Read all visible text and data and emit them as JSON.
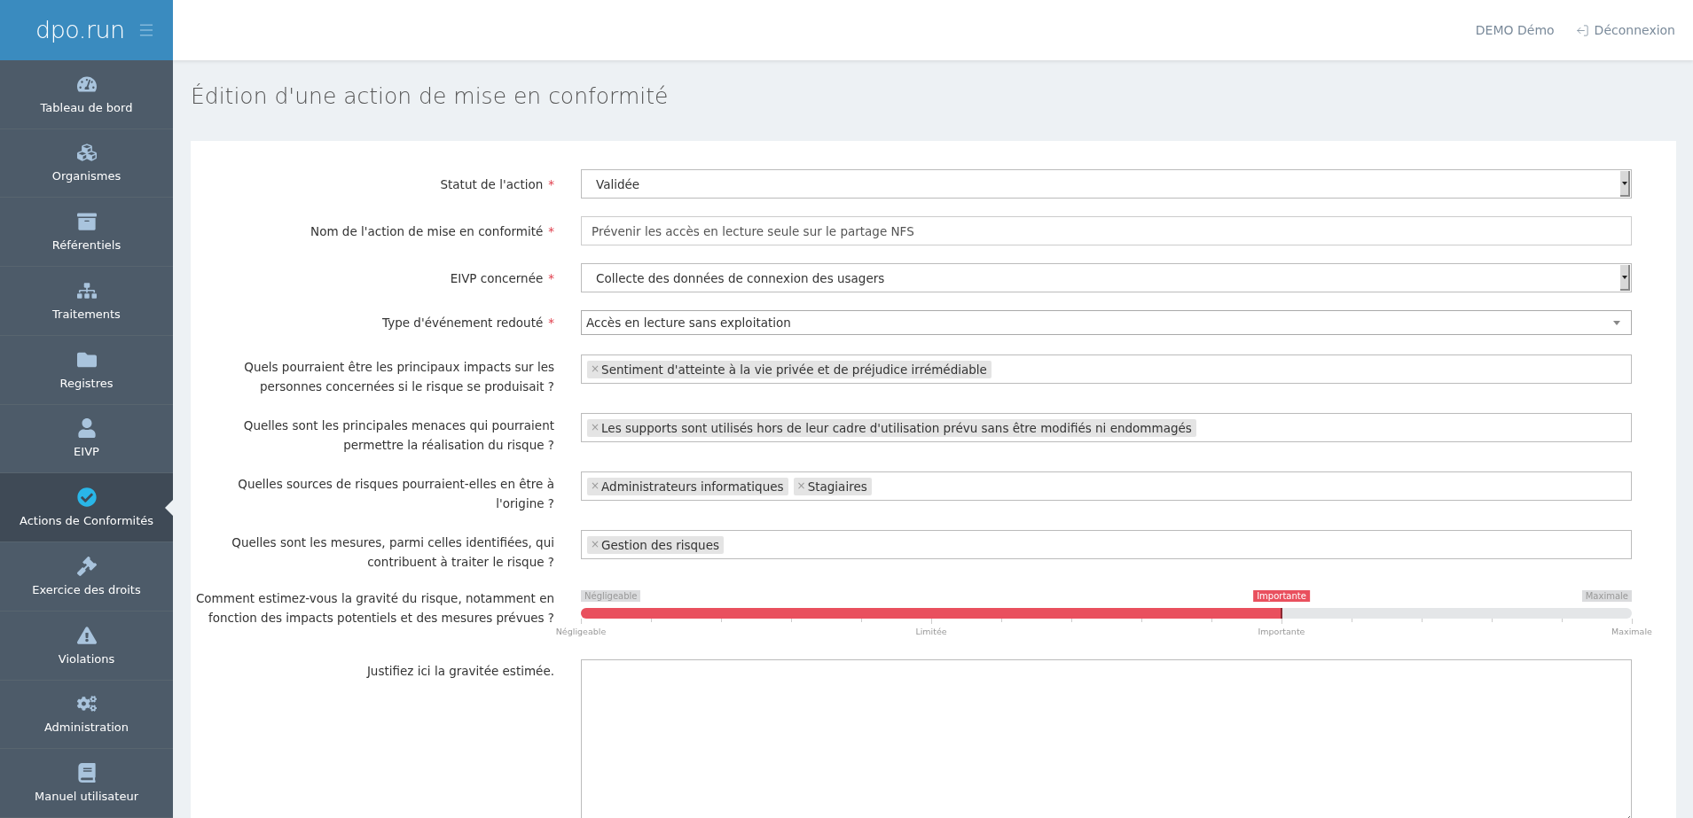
{
  "sidebar": {
    "logo": "dpo.run",
    "items": [
      {
        "label": "Tableau de bord",
        "selected": false
      },
      {
        "label": "Organismes",
        "selected": false
      },
      {
        "label": "Référentiels",
        "selected": false
      },
      {
        "label": "Traitements",
        "selected": false
      },
      {
        "label": "Registres",
        "selected": false
      },
      {
        "label": "EIVP",
        "selected": false
      },
      {
        "label": "Actions de Conformités",
        "selected": true
      },
      {
        "label": "Exercice des droits",
        "selected": false
      },
      {
        "label": "Violations",
        "selected": false
      },
      {
        "label": "Administration",
        "selected": false
      },
      {
        "label": "Manuel utilisateur",
        "selected": false
      }
    ]
  },
  "header": {
    "user": "DEMO Démo",
    "logout": "Déconnexion"
  },
  "page_title": "Édition d'une action de mise en conformité",
  "form": {
    "fields": [
      {
        "kind": "select",
        "label": "Statut de l'action",
        "required_mark": "*",
        "value": "Validée"
      },
      {
        "kind": "text",
        "label": "Nom de l'action de mise en conformité",
        "required_mark": "*",
        "value": "Prévenir les accès en lecture seule sur le partage NFS"
      },
      {
        "kind": "select",
        "label": "EIVP concernée",
        "required_mark": "*",
        "value": "Collecte des données de connexion des usagers"
      },
      {
        "kind": "dropdown",
        "label": "Type d'événement redouté",
        "required_mark": "*",
        "value": "Accès en lecture sans exploitation"
      },
      {
        "kind": "tags",
        "label": "Quels pourraient être les principaux impacts sur les personnes concernées si le risque se produisait ?",
        "tags": [
          {
            "remove": "×",
            "label": "Sentiment d'atteinte à la vie privée et de préjudice irrémédiable"
          }
        ]
      },
      {
        "kind": "tags",
        "label": "Quelles sont les principales menaces qui pourraient permettre la réalisation du risque ?",
        "tags": [
          {
            "remove": "×",
            "label": "Les supports sont utilisés hors de leur cadre d'utilisation prévu sans être modifiés ni endommagés"
          }
        ]
      },
      {
        "kind": "tags",
        "label": "Quelles sources de risques pourraient-elles en être à l'origine ?",
        "tags": [
          {
            "remove": "×",
            "label": "Administrateurs informatiques"
          },
          {
            "remove": "×",
            "label": "Stagiaires"
          }
        ]
      },
      {
        "kind": "tags",
        "label": "Quelles sont les mesures, parmi celles identifiées, qui contribuent à traiter le risque ?",
        "tags": [
          {
            "remove": "×",
            "label": "Gestion des risques"
          }
        ]
      },
      {
        "kind": "slider",
        "label": "Comment estimez-vous la gravité du risque, notamment en fonction des impacts potentiels et des mesures prévues ?",
        "min_label": "Négligeable",
        "max_label": "Maximale",
        "current_label": "Importante",
        "level": 0.6667,
        "tick_labels": [
          "Négligeable",
          "Limitée",
          "Importante",
          "Maximale"
        ]
      },
      {
        "kind": "textarea",
        "label": "Justifiez ici la gravitée estimée."
      }
    ]
  }
}
